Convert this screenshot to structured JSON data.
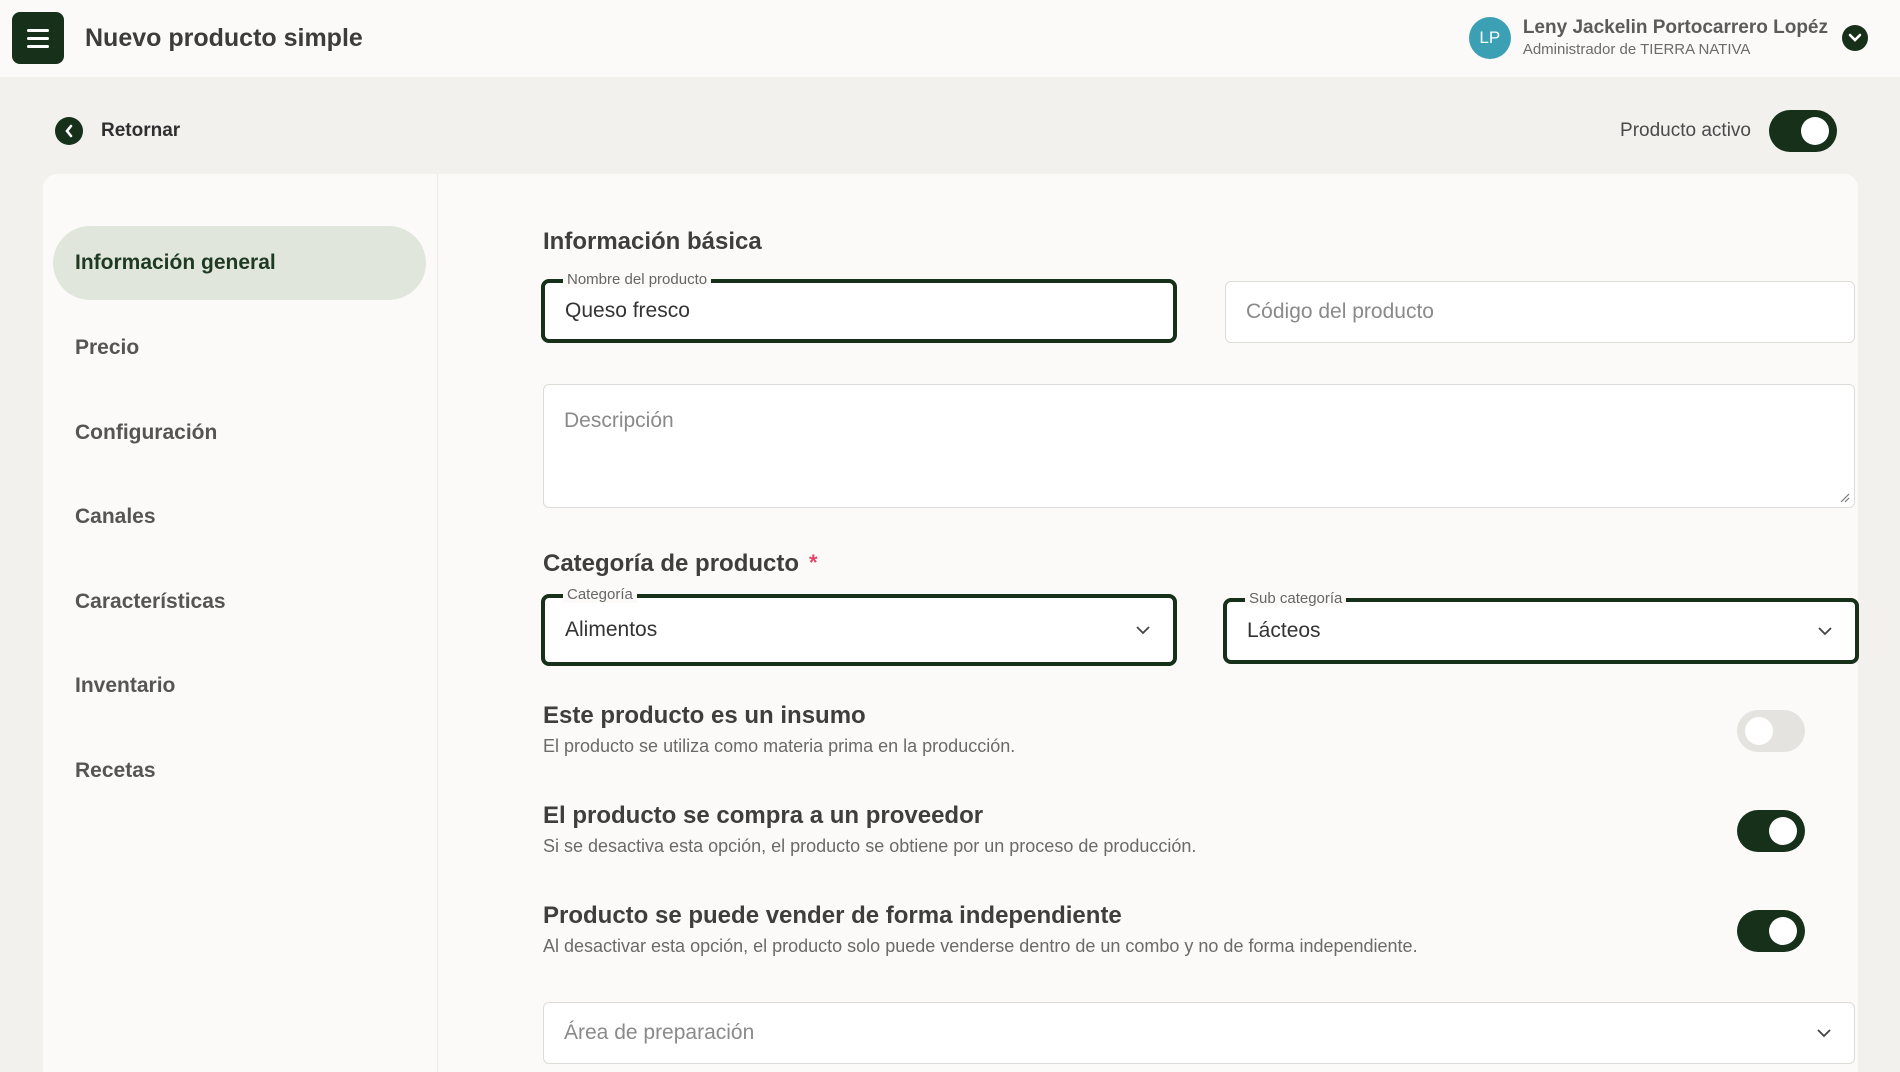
{
  "header": {
    "title": "Nuevo producto simple",
    "user": {
      "initials": "LP",
      "name": "Leny Jackelin Portocarrero Lopéz",
      "role": "Administrador de TIERRA NATIVA"
    }
  },
  "back_label": "Retornar",
  "product_active": {
    "label": "Producto activo",
    "checked": true
  },
  "sidebar": {
    "items": [
      {
        "label": "Información general",
        "active": true
      },
      {
        "label": "Precio"
      },
      {
        "label": "Configuración"
      },
      {
        "label": "Canales"
      },
      {
        "label": "Características"
      },
      {
        "label": "Inventario"
      },
      {
        "label": "Recetas"
      }
    ]
  },
  "basic": {
    "title": "Información básica",
    "name_label": "Nombre del producto",
    "name_value": "Queso fresco",
    "code_placeholder": "Código del producto",
    "description_placeholder": "Descripción"
  },
  "category": {
    "title": "Categoría de producto",
    "required_mark": "*",
    "category_label": "Categoría",
    "category_value": "Alimentos",
    "subcategory_label": "Sub categoría",
    "subcategory_value": "Lácteos"
  },
  "options": [
    {
      "title": "Este producto es un insumo",
      "desc": "El producto se utiliza como materia prima en la producción.",
      "checked": false
    },
    {
      "title": "El producto se compra a un proveedor",
      "desc": "Si se desactiva esta opción, el producto se obtiene por un proceso de producción.",
      "checked": true
    },
    {
      "title": "Producto se puede vender de forma independiente",
      "desc": "Al desactivar esta opción, el producto solo puede venderse dentro de un combo y no de forma independiente.",
      "checked": true
    }
  ],
  "prep_area_placeholder": "Área de preparación",
  "colors": {
    "primary": "#16301a",
    "avatar": "#3ca0b4",
    "required": "#e0456a",
    "active_nav_bg": "#e1e6dd"
  }
}
